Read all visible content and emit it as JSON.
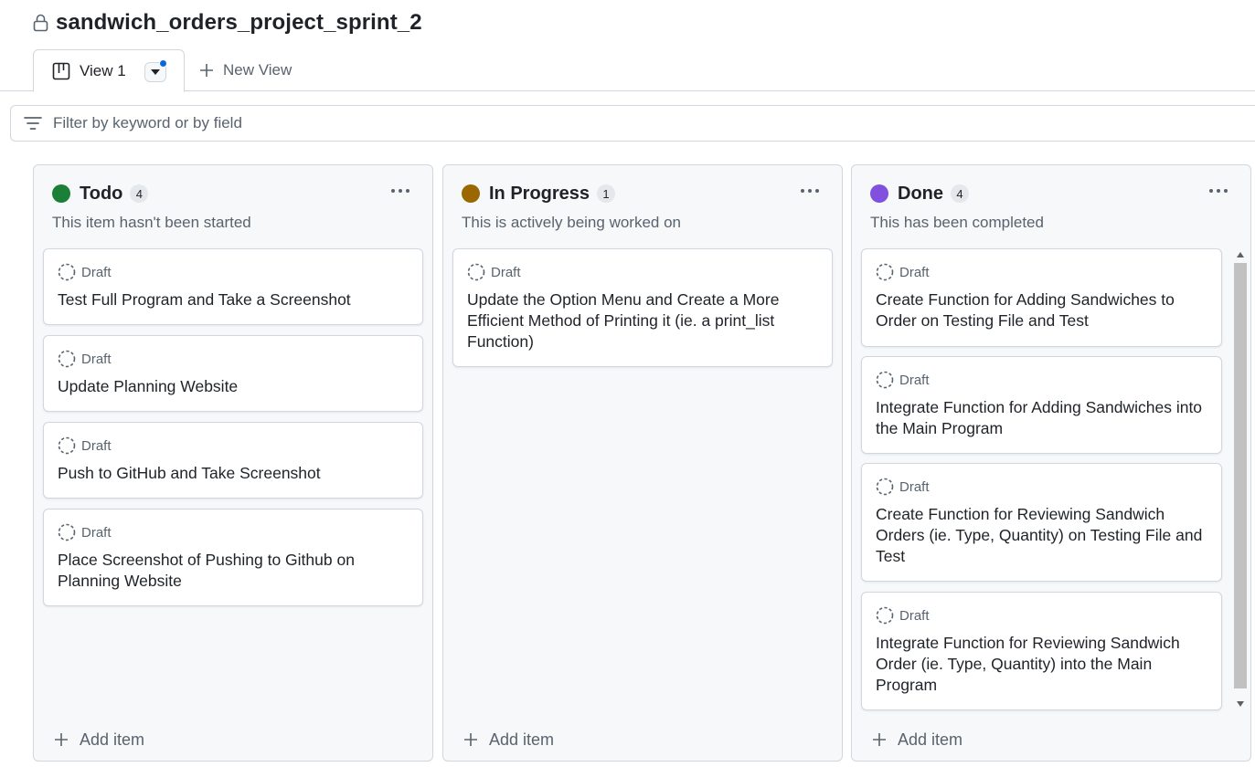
{
  "project": {
    "title": "sandwich_orders_project_sprint_2",
    "lock_icon": "lock-icon"
  },
  "tabs": {
    "view_label": "View 1",
    "new_view_label": "New View"
  },
  "filter": {
    "placeholder": "Filter by keyword or by field"
  },
  "columns": [
    {
      "title": "Todo",
      "count": "4",
      "color": "#1a7f37",
      "description": "This item hasn't been started",
      "add_label": "Add item",
      "cards": [
        {
          "draft": "Draft",
          "title": "Test Full Program and Take a Screenshot"
        },
        {
          "draft": "Draft",
          "title": "Update Planning Website"
        },
        {
          "draft": "Draft",
          "title": "Push to GitHub and Take Screenshot"
        },
        {
          "draft": "Draft",
          "title": "Place Screenshot of Pushing to Github on Planning Website"
        }
      ]
    },
    {
      "title": "In Progress",
      "count": "1",
      "color": "#9a6700",
      "description": "This is actively being worked on",
      "add_label": "Add item",
      "cards": [
        {
          "draft": "Draft",
          "title": "Update the Option Menu and Create a More Efficient Method of Printing it (ie. a print_list Function)"
        }
      ]
    },
    {
      "title": "Done",
      "count": "4",
      "color": "#8250df",
      "description": "This has been completed",
      "add_label": "Add item",
      "cards": [
        {
          "draft": "Draft",
          "title": "Create Function for Adding Sandwiches to Order on Testing File and Test"
        },
        {
          "draft": "Draft",
          "title": "Integrate Function for Adding Sandwiches into the Main Program"
        },
        {
          "draft": "Draft",
          "title": "Create Function for Reviewing Sandwich Orders (ie. Type, Quantity) on Testing File and Test"
        },
        {
          "draft": "Draft",
          "title": "Integrate Function for Reviewing Sandwich Order (ie. Type, Quantity) into the Main Program"
        }
      ]
    }
  ]
}
